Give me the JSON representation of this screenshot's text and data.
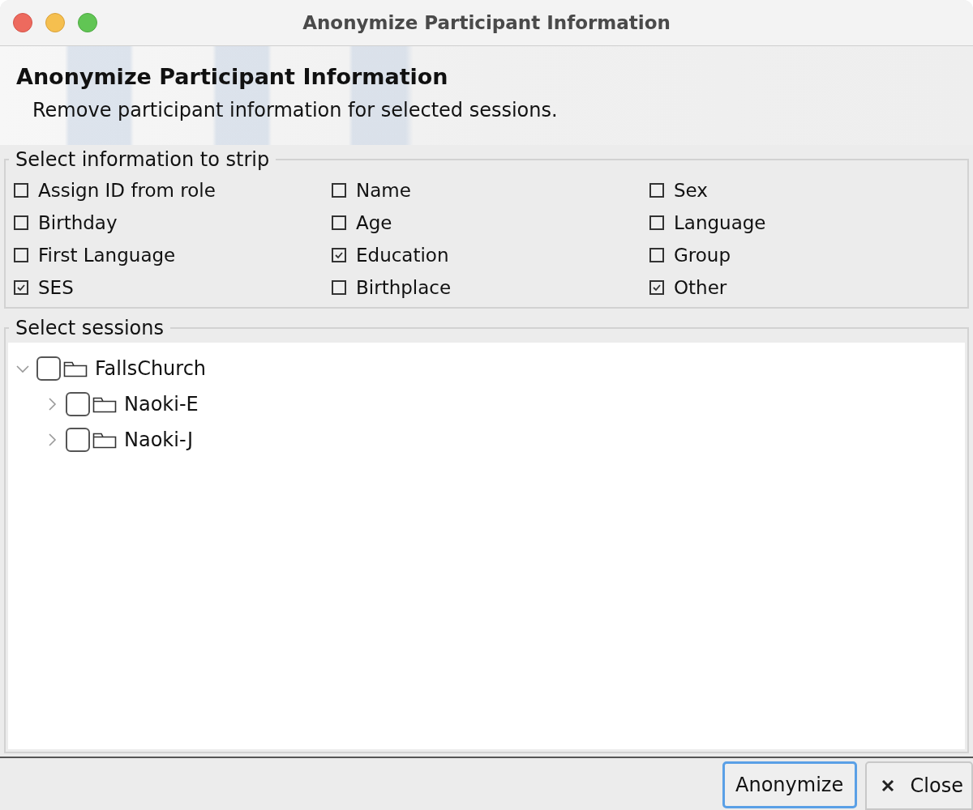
{
  "window": {
    "title": "Anonymize Participant Information"
  },
  "header": {
    "title": "Anonymize Participant Information",
    "subtitle": "Remove participant information for selected sessions."
  },
  "strip_group": {
    "legend": "Select information to strip",
    "options": [
      {
        "label": "Assign ID from role",
        "checked": false
      },
      {
        "label": "Name",
        "checked": false
      },
      {
        "label": "Sex",
        "checked": false
      },
      {
        "label": "Birthday",
        "checked": false
      },
      {
        "label": "Age",
        "checked": false
      },
      {
        "label": "Language",
        "checked": false
      },
      {
        "label": "First Language",
        "checked": false
      },
      {
        "label": "Education",
        "checked": true
      },
      {
        "label": "Group",
        "checked": false
      },
      {
        "label": "SES",
        "checked": true
      },
      {
        "label": "Birthplace",
        "checked": false
      },
      {
        "label": "Other",
        "checked": true
      }
    ]
  },
  "sessions_group": {
    "legend": "Select sessions",
    "tree": [
      {
        "label": "FallsChurch",
        "checked": false,
        "expanded": true,
        "children": [
          {
            "label": "Naoki-E",
            "checked": false,
            "expanded": false
          },
          {
            "label": "Naoki-J",
            "checked": false,
            "expanded": false
          }
        ]
      }
    ]
  },
  "buttons": [
    {
      "label": "Anonymize",
      "kind": "default"
    },
    {
      "label": "Close",
      "kind": "close"
    }
  ]
}
